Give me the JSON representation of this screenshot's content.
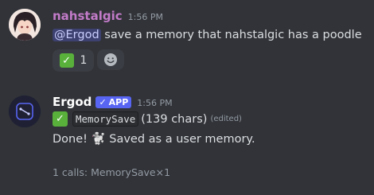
{
  "colors": {
    "background": "#313338",
    "user_name": "#c27bc8",
    "bot_name": "#ffffff",
    "mention_bg": "#3c4270",
    "badge": "#5865f2",
    "check": "#59b13b"
  },
  "message1": {
    "username": "nahstalgic",
    "timestamp": "1:56 PM",
    "mention": "@Ergod",
    "text": " save a memory that nahstalgic has a poodle",
    "reactions": [
      {
        "icon": "check-mark-icon",
        "count": "1"
      },
      {
        "icon": "add-reaction-icon"
      }
    ]
  },
  "message2": {
    "username": "Ergod",
    "badge_check": "✓",
    "badge_label": "APP",
    "timestamp": "1:56 PM",
    "tool_icon": "check-mark-icon",
    "tool_name": "MemorySave",
    "tool_detail": "(139 chars)",
    "edited": "(edited)",
    "result_pre": "Done! ",
    "result_icon": "poodle-icon",
    "result_emoji": "🐩",
    "result_post": " Saved as a user memory.",
    "footer": "1 calls: MemorySave×1"
  }
}
